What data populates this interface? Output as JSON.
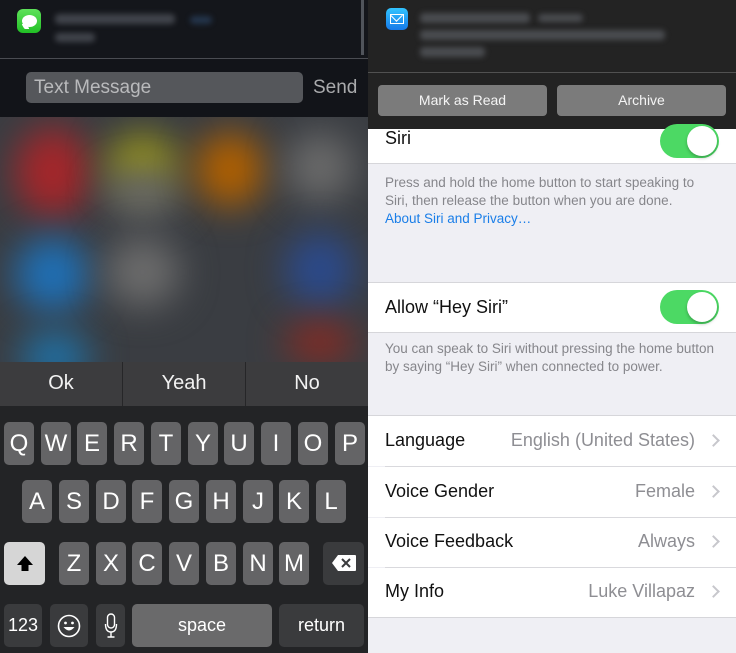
{
  "left_panel": {
    "notification": {
      "app_icon": "messages-icon",
      "sender_blurred": true
    },
    "reply": {
      "placeholder": "Text Message",
      "value": "",
      "send_label": "Send"
    },
    "quick_replies": [
      "Ok",
      "Yeah",
      "No"
    ],
    "keyboard": {
      "row1": [
        "Q",
        "W",
        "E",
        "R",
        "T",
        "Y",
        "U",
        "I",
        "O",
        "P"
      ],
      "row2": [
        "A",
        "S",
        "D",
        "F",
        "G",
        "H",
        "J",
        "K",
        "L"
      ],
      "row3": [
        "Z",
        "X",
        "C",
        "V",
        "B",
        "N",
        "M"
      ],
      "shift_icon": "shift-icon",
      "delete_icon": "delete-icon",
      "numbers_label": "123",
      "emoji_icon": "emoji-icon",
      "mic_icon": "microphone-icon",
      "space_label": "space",
      "return_label": "return"
    }
  },
  "right_panel": {
    "notification": {
      "app_icon": "mail-icon",
      "content_blurred": true,
      "actions": [
        "Mark as Read",
        "Archive"
      ]
    },
    "settings": {
      "siri": {
        "label": "Siri",
        "enabled": true
      },
      "siri_footer": "Press and hold the home button to start speaking to Siri, then release the button when you are done.",
      "siri_link": "About Siri and Privacy…",
      "hey_siri": {
        "label": "Allow “Hey Siri”",
        "enabled": true
      },
      "hey_siri_footer": "You can speak to Siri without pressing the home button by saying “Hey Siri” when connected to power.",
      "rows": [
        {
          "label": "Language",
          "value": "English (United States)"
        },
        {
          "label": "Voice Gender",
          "value": "Female"
        },
        {
          "label": "Voice Feedback",
          "value": "Always"
        },
        {
          "label": "My Info",
          "value": "Luke Villapaz"
        }
      ]
    },
    "colors": {
      "toggle_on": "#4cd964",
      "link": "#1a7ee8"
    }
  }
}
